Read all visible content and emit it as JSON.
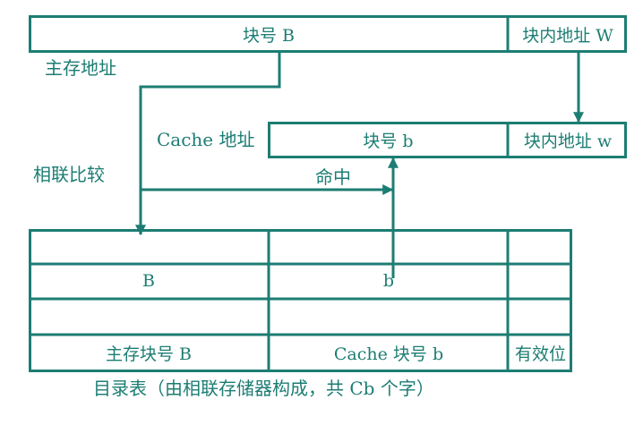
{
  "main_address": {
    "label": "主存地址",
    "block_field": "块号 B",
    "word_field": "块内地址 W"
  },
  "cache_address": {
    "label": "Cache 地址",
    "block_field": "块号 b",
    "word_field": "块内地址 w"
  },
  "compare_label": "相联比较",
  "hit_label": "命中",
  "directory": {
    "cell_B": "B",
    "cell_b": "b",
    "footer": {
      "main_block": "主存块号 B",
      "cache_block": "Cache 块号 b",
      "valid_bit": "有效位"
    },
    "caption": "目录表（由相联存储器构成，共 Cb 个字）"
  },
  "colors": {
    "line": "#1c7d73",
    "text": "#1c7d73",
    "background": "#ffffff"
  }
}
